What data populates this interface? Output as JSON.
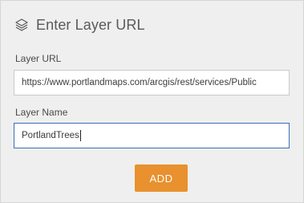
{
  "header": {
    "title": "Enter Layer URL",
    "icon": "layers-icon"
  },
  "form": {
    "url_label": "Layer URL",
    "url_value": "https://www.portlandmaps.com/arcgis/rest/services/Public",
    "name_label": "Layer Name",
    "name_value": "PortlandTrees"
  },
  "actions": {
    "add_label": "ADD"
  },
  "colors": {
    "accent": "#e8912e",
    "focus_border": "#3a6fb5",
    "background": "#efefef"
  }
}
